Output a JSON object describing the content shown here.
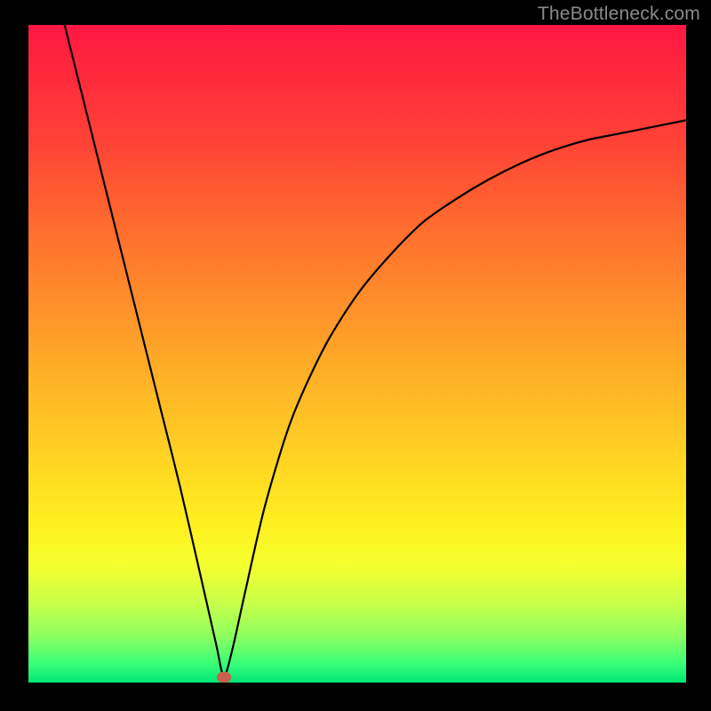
{
  "watermark": "TheBottleneck.com",
  "marker": {
    "cx_frac": 0.297,
    "cy_frac": 0.992
  },
  "chart_data": {
    "type": "line",
    "title": "",
    "xlabel": "",
    "ylabel": "",
    "xlim": [
      0,
      1
    ],
    "ylim": [
      0,
      1
    ],
    "note": "No axis ticks or numeric labels are visible; x and y are expressed as fractions of the plot area (0 = left/bottom, 1 = right/top). The curve shows a V-shaped dip reaching ~0 near x≈0.30 then recovering toward ~0.85 at x=1.",
    "series": [
      {
        "name": "curve",
        "x": [
          0.055,
          0.08,
          0.11,
          0.14,
          0.17,
          0.2,
          0.23,
          0.26,
          0.285,
          0.297,
          0.31,
          0.33,
          0.36,
          0.4,
          0.45,
          0.5,
          0.55,
          0.6,
          0.65,
          0.7,
          0.75,
          0.8,
          0.85,
          0.9,
          0.95,
          1.0
        ],
        "y": [
          1.0,
          0.9,
          0.78,
          0.66,
          0.54,
          0.42,
          0.3,
          0.17,
          0.06,
          0.01,
          0.05,
          0.14,
          0.27,
          0.4,
          0.51,
          0.59,
          0.65,
          0.7,
          0.735,
          0.765,
          0.79,
          0.81,
          0.825,
          0.835,
          0.845,
          0.855
        ]
      }
    ],
    "annotations": [
      {
        "type": "marker",
        "x": 0.297,
        "y": 0.008,
        "color": "#c7604e",
        "shape": "pill"
      }
    ],
    "background_gradient_top_to_bottom": [
      "#ff1744",
      "#ff8e2a",
      "#fff020",
      "#00e676"
    ]
  }
}
